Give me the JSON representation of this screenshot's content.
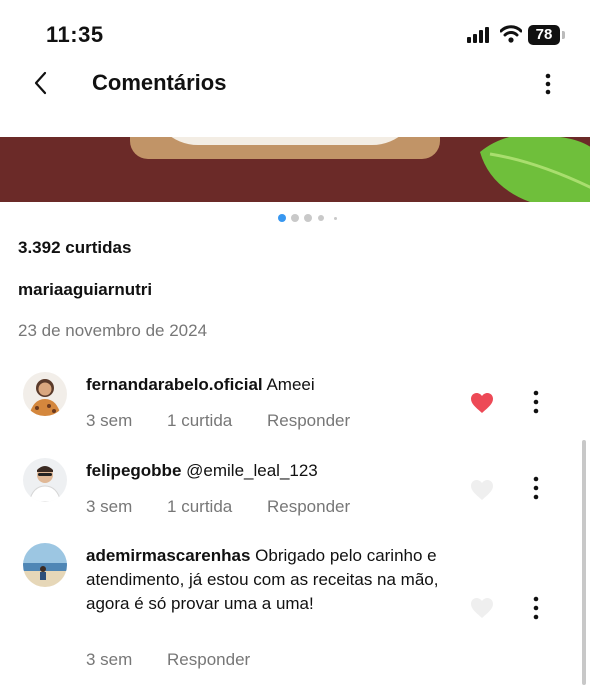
{
  "status_bar": {
    "time": "11:35",
    "battery": "78"
  },
  "header": {
    "title": "Comentários"
  },
  "post": {
    "likes": "3.392 curtidas",
    "author": "mariaaguiarnutri",
    "date": "23 de novembro de 2024"
  },
  "comments": [
    {
      "username": "fernandarabelo.oficial",
      "text": "Ameei",
      "time": "3 sem",
      "likes": "1 curtida",
      "reply": "Responder",
      "liked": true
    },
    {
      "username": "felipegobbe",
      "text": "@emile_leal_123",
      "time": "3 sem",
      "likes": "1 curtida",
      "reply": "Responder",
      "liked": false
    },
    {
      "username": "ademirmascarenhas",
      "text": "Obrigado pelo carinho e atendimento, já estou com as receitas na mão, agora é só provar uma a uma!",
      "time": "3 sem",
      "reply": "Responder",
      "liked": false
    }
  ],
  "colors": {
    "like_red": "#ed4956",
    "meta_gray": "#777777"
  }
}
